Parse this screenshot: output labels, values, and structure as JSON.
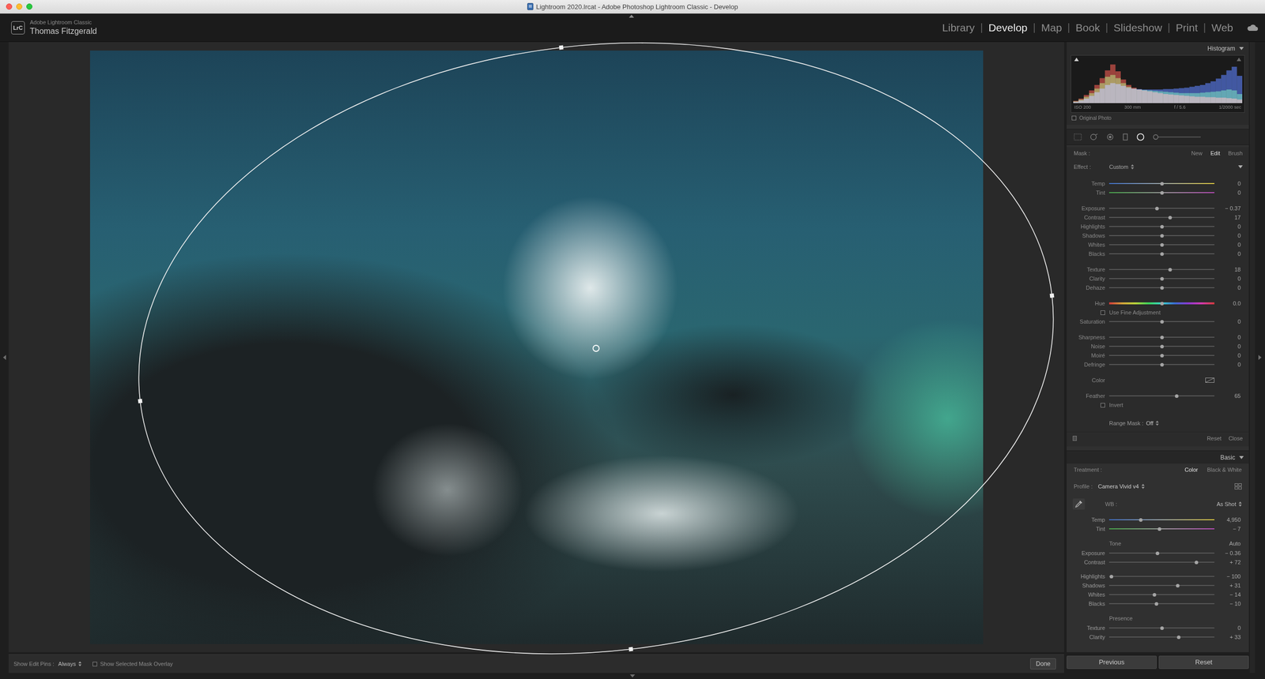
{
  "window": {
    "title": "Lightroom 2020.lrcat - Adobe Photoshop Lightroom Classic - Develop"
  },
  "identity": {
    "logo": "LrC",
    "product": "Adobe Lightroom Classic",
    "user": "Thomas Fitzgerald"
  },
  "modules": {
    "separator": "|",
    "items": [
      {
        "label": "Library",
        "selected": false
      },
      {
        "label": "Develop",
        "selected": true
      },
      {
        "label": "Map",
        "selected": false
      },
      {
        "label": "Book",
        "selected": false
      },
      {
        "label": "Slideshow",
        "selected": false
      },
      {
        "label": "Print",
        "selected": false
      },
      {
        "label": "Web",
        "selected": false
      }
    ]
  },
  "toolbar": {
    "pins_label": "Show Edit Pins :",
    "pins_value": "Always",
    "overlay": {
      "label": "Show Selected Mask Overlay",
      "checked": false
    },
    "done": "Done"
  },
  "histogram": {
    "title": "Histogram",
    "info": [
      "ISO 200",
      "300 mm",
      "f / 5.6",
      "1/2000 sec"
    ],
    "series": [
      {
        "color": "#c03a32",
        "values": [
          5,
          10,
          18,
          28,
          40,
          55,
          72,
          85,
          70,
          52,
          40,
          34,
          30,
          28,
          26,
          24,
          22,
          20,
          19,
          18,
          17,
          16,
          15,
          14,
          14,
          13,
          13,
          12,
          12,
          11,
          10,
          8
        ]
      },
      {
        "color": "#3aa045",
        "values": [
          4,
          8,
          14,
          22,
          32,
          44,
          58,
          62,
          55,
          44,
          36,
          32,
          30,
          29,
          28,
          27,
          26,
          25,
          24,
          23,
          22,
          22,
          22,
          22,
          23,
          24,
          25,
          26,
          28,
          30,
          28,
          20
        ]
      },
      {
        "color": "#3a5cc8",
        "values": [
          3,
          6,
          10,
          16,
          24,
          32,
          40,
          44,
          42,
          38,
          34,
          32,
          31,
          30,
          30,
          30,
          30,
          31,
          31,
          32,
          33,
          34,
          36,
          38,
          40,
          44,
          48,
          54,
          62,
          72,
          80,
          60
        ]
      }
    ],
    "original_photo": {
      "label": "Original Photo",
      "checked": false
    }
  },
  "tools": [
    {
      "selected": false
    },
    {
      "selected": false
    },
    {
      "selected": false
    },
    {
      "selected": false
    },
    {
      "selected": true
    },
    {
      "selected": false
    }
  ],
  "mask": {
    "label": "Mask :",
    "actions": [
      {
        "label": "New",
        "selected": false
      },
      {
        "label": "Edit",
        "selected": true
      },
      {
        "label": "Brush",
        "selected": false
      }
    ],
    "effect_label": "Effect :",
    "effect_value": "Custom",
    "groups": [
      {
        "rows": [
          {
            "label": "Temp",
            "kind": "temp",
            "level": 0.5,
            "value": "0"
          },
          {
            "label": "Tint",
            "kind": "tint",
            "level": 0.5,
            "value": "0"
          }
        ]
      },
      {
        "rows": [
          {
            "label": "Exposure",
            "kind": "slider",
            "level": 0.455,
            "value": "− 0.37"
          },
          {
            "label": "Contrast",
            "kind": "slider",
            "level": 0.58,
            "value": "17"
          },
          {
            "label": "Highlights",
            "kind": "slider",
            "level": 0.5,
            "value": "0"
          },
          {
            "label": "Shadows",
            "kind": "slider",
            "level": 0.5,
            "value": "0"
          },
          {
            "label": "Whites",
            "kind": "slider",
            "level": 0.5,
            "value": "0"
          },
          {
            "label": "Blacks",
            "kind": "slider",
            "level": 0.5,
            "value": "0"
          }
        ]
      },
      {
        "rows": [
          {
            "label": "Texture",
            "kind": "slider",
            "level": 0.58,
            "value": "18"
          },
          {
            "label": "Clarity",
            "kind": "slider",
            "level": 0.5,
            "value": "0"
          },
          {
            "label": "Dehaze",
            "kind": "slider",
            "level": 0.5,
            "value": "0"
          }
        ]
      },
      {
        "rows": [
          {
            "label": "Hue",
            "kind": "hue",
            "level": 0.5,
            "value": "0.0"
          },
          {
            "label": "Use Fine Adjustment",
            "kind": "checkbox",
            "checked": false
          },
          {
            "label": "Saturation",
            "kind": "slider",
            "level": 0.5,
            "value": "0"
          }
        ]
      },
      {
        "rows": [
          {
            "label": "Sharpness",
            "kind": "slider",
            "level": 0.5,
            "value": "0"
          },
          {
            "label": "Noise",
            "kind": "slider",
            "level": 0.5,
            "value": "0"
          },
          {
            "label": "Moiré",
            "kind": "slider",
            "level": 0.5,
            "value": "0"
          },
          {
            "label": "Defringe",
            "kind": "slider",
            "level": 0.5,
            "value": "0"
          }
        ]
      },
      {
        "rows": [
          {
            "label": "Color",
            "kind": "swatch"
          }
        ]
      },
      {
        "rows": [
          {
            "label": "Feather",
            "kind": "slider",
            "level": 0.64,
            "value": "65"
          },
          {
            "label": "Invert",
            "kind": "checkbox",
            "checked": false
          }
        ]
      }
    ],
    "range_mask": {
      "label": "Range Mask :",
      "value": "Off"
    },
    "footer": [
      "Reset",
      "Close"
    ]
  },
  "basic": {
    "title": "Basic",
    "treatment": {
      "label": "Treatment :",
      "options": [
        {
          "label": "Color",
          "selected": true
        },
        {
          "label": "Black & White",
          "selected": false
        }
      ]
    },
    "profile": {
      "label": "Profile :",
      "value": "Camera Vivid v4"
    },
    "wb": {
      "label": "WB :",
      "value": "As Shot"
    },
    "groups": [
      {
        "heading": "",
        "action": "",
        "rows": [
          {
            "label": "Temp",
            "kind": "temp",
            "level": 0.3,
            "value": "4,950"
          },
          {
            "label": "Tint",
            "kind": "tint",
            "level": 0.48,
            "value": "− 7"
          }
        ]
      },
      {
        "heading": "Tone",
        "action": "Auto",
        "rows": [
          {
            "label": "Exposure",
            "kind": "slider",
            "level": 0.46,
            "value": "− 0.36"
          },
          {
            "label": "Contrast",
            "kind": "slider",
            "level": 0.83,
            "value": "+ 72"
          }
        ]
      },
      {
        "heading": "",
        "action": "",
        "rows": [
          {
            "label": "Highlights",
            "kind": "slider",
            "level": 0.02,
            "value": "− 100"
          },
          {
            "label": "Shadows",
            "kind": "slider",
            "level": 0.65,
            "value": "+ 31"
          },
          {
            "label": "Whites",
            "kind": "slider",
            "level": 0.43,
            "value": "− 14"
          },
          {
            "label": "Blacks",
            "kind": "slider",
            "level": 0.45,
            "value": "− 10"
          }
        ]
      },
      {
        "heading": "Presence",
        "action": "",
        "rows": [
          {
            "label": "Texture",
            "kind": "slider",
            "level": 0.5,
            "value": "0"
          },
          {
            "label": "Clarity",
            "kind": "slider",
            "level": 0.66,
            "value": "+ 33"
          }
        ]
      }
    ]
  },
  "buttons": [
    "Previous",
    "Reset"
  ]
}
